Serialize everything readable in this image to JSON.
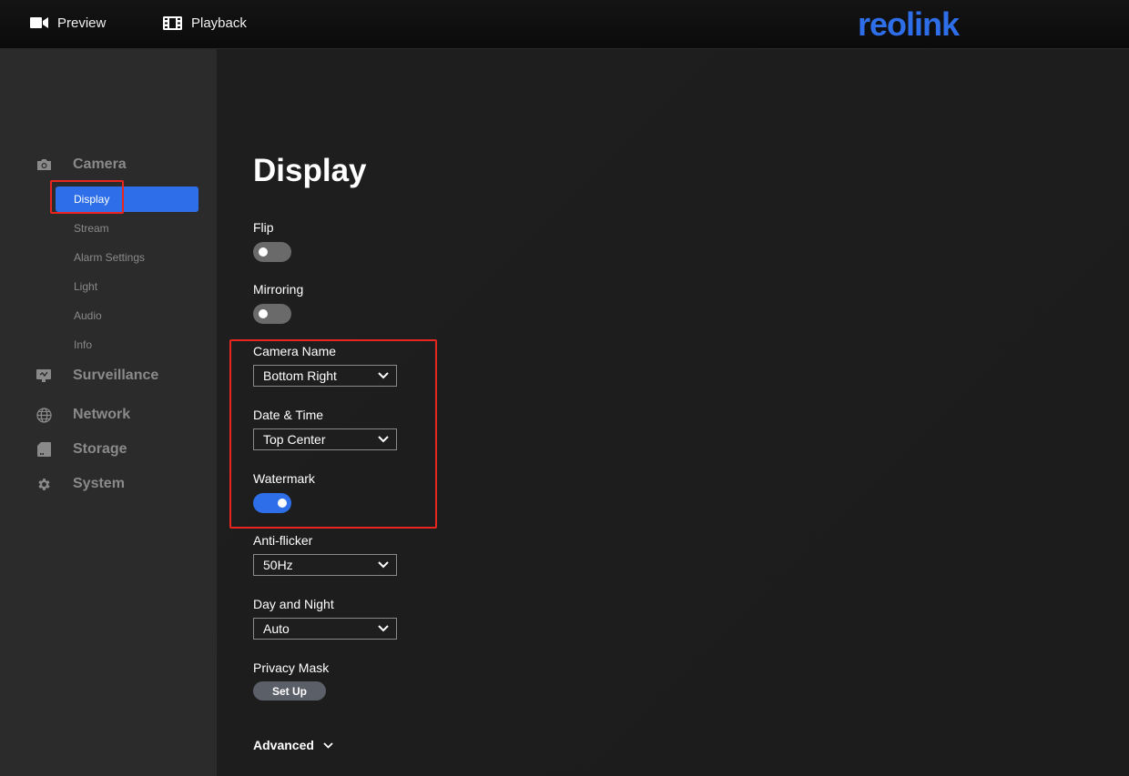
{
  "topbar": {
    "preview_label": "Preview",
    "playback_label": "Playback",
    "logo_text": "reolink",
    "logo_color": "#2e6ee8"
  },
  "sidebar": {
    "camera": {
      "label": "Camera",
      "icon": "camera-icon",
      "items": [
        {
          "label": "Display",
          "active": true
        },
        {
          "label": "Stream"
        },
        {
          "label": "Alarm Settings"
        },
        {
          "label": "Light"
        },
        {
          "label": "Audio"
        },
        {
          "label": "Info"
        }
      ]
    },
    "sections": [
      {
        "label": "Surveillance",
        "icon": "monitor-icon"
      },
      {
        "label": "Network",
        "icon": "globe-icon"
      },
      {
        "label": "Storage",
        "icon": "sd-card-icon"
      },
      {
        "label": "System",
        "icon": "gear-icon"
      }
    ]
  },
  "main": {
    "title": "Display",
    "flip": {
      "label": "Flip",
      "on": false
    },
    "mirroring": {
      "label": "Mirroring",
      "on": false
    },
    "camera_name": {
      "label": "Camera Name",
      "value": "Bottom Right"
    },
    "date_time": {
      "label": "Date & Time",
      "value": "Top Center"
    },
    "watermark": {
      "label": "Watermark",
      "on": true
    },
    "anti_flicker": {
      "label": "Anti-flicker",
      "value": "50Hz"
    },
    "day_night": {
      "label": "Day and Night",
      "value": "Auto"
    },
    "privacy_mask": {
      "label": "Privacy Mask",
      "button": "Set Up"
    },
    "advanced": {
      "label": "Advanced"
    }
  },
  "colors": {
    "accent": "#2e6ee8",
    "highlight": "#e8251f",
    "sidebar_bg": "#2b2b2b",
    "main_bg": "#1f1f1f"
  }
}
